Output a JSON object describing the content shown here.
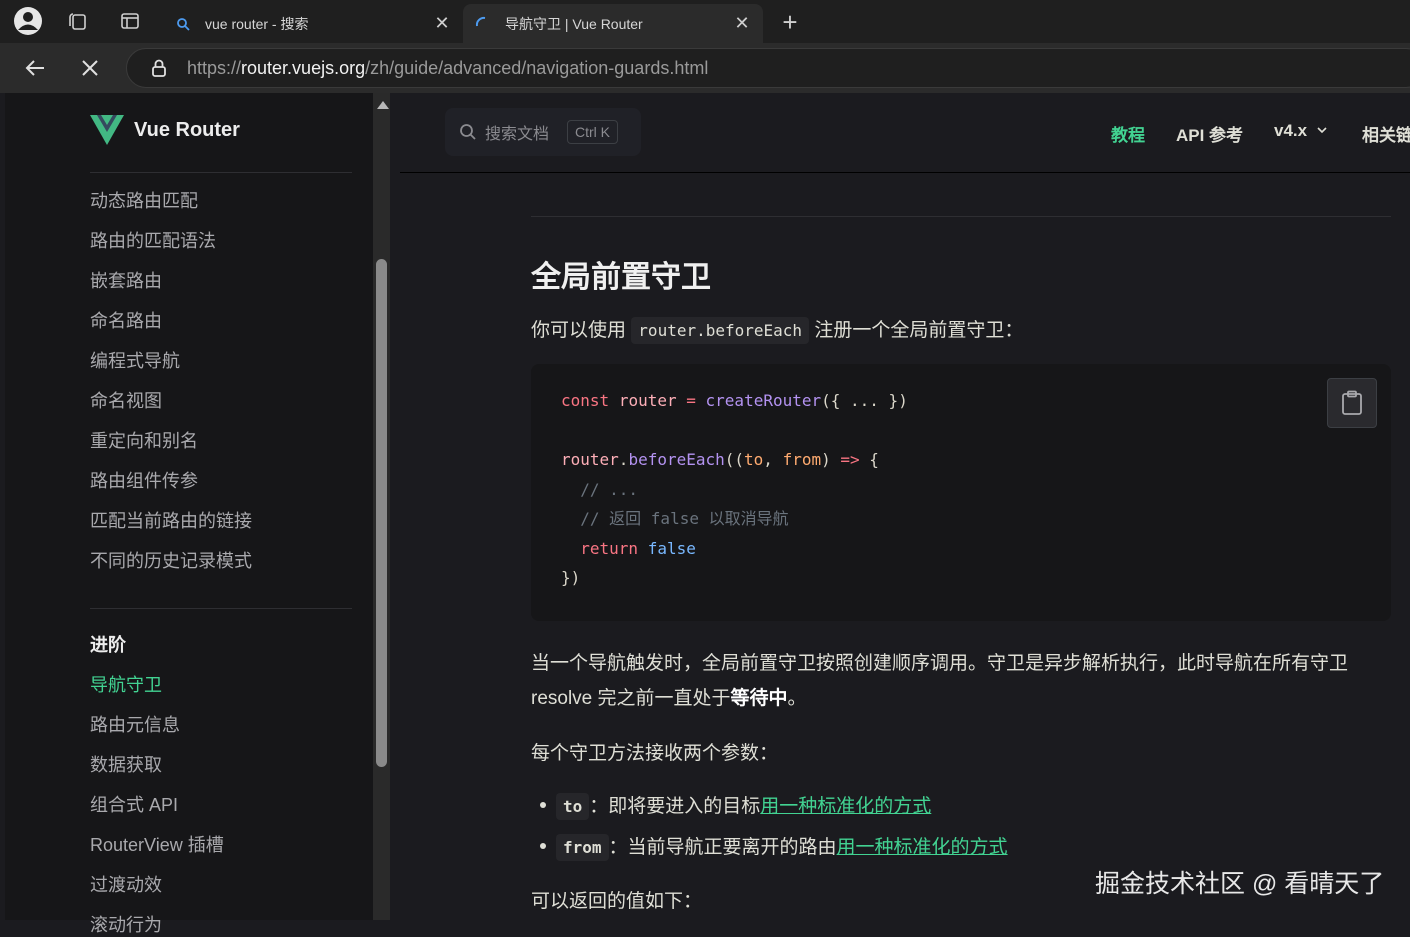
{
  "browser": {
    "tabs": [
      {
        "title": "vue router - 搜索",
        "favicon": "search-icon"
      },
      {
        "title": "导航守卫 | Vue Router",
        "favicon": "loading-spinner-icon"
      }
    ],
    "url_scheme": "https://",
    "url_host": "router.vuejs.org",
    "url_path": "/zh/guide/advanced/navigation-guards.html"
  },
  "sidebar": {
    "logo_text": "Vue Router",
    "items": [
      "动态路由匹配",
      "路由的匹配语法",
      "嵌套路由",
      "命名路由",
      "编程式导航",
      "命名视图",
      "重定向和别名",
      "路由组件传参",
      "匹配当前路由的链接",
      "不同的历史记录模式"
    ],
    "section_heading": "进阶",
    "advanced_items": [
      "导航守卫",
      "路由元信息",
      "数据获取",
      "组合式 API",
      "RouterView 插槽",
      "过渡动效",
      "滚动行为"
    ]
  },
  "topnav": {
    "search_placeholder": "搜索文档",
    "search_shortcut": "Ctrl K",
    "links": [
      "教程",
      "API 参考",
      "v4.x",
      "相关链接"
    ]
  },
  "content": {
    "heading": "全局前置守卫",
    "intro_before": "你可以使用",
    "intro_code": "router.beforeEach",
    "intro_after": "注册一个全局前置守卫：",
    "para1_line1": "当一个导航触发时，全局前置守卫按照创建顺序调用。守卫是异步解析执行，此时导航在所有守卫",
    "para1_line2_before": "resolve 完之前一直处于",
    "para1_line2_bold": "等待中",
    "para1_line2_end": "。",
    "para2": "每个守卫方法接收两个参数：",
    "bullets": [
      {
        "code": "to",
        "text": "：即将要进入的目标",
        "link": "用一种标准化的方式"
      },
      {
        "code": "from",
        "text": "：当前导航正要离开的路由",
        "link": "用一种标准化的方式"
      }
    ],
    "para3": "可以返回的值如下："
  },
  "watermark": "掘金技术社区 @ 看晴天了",
  "colors": {
    "accent": "#42d392",
    "background": "#1b1b1f",
    "sidebar_bg": "#161618"
  }
}
